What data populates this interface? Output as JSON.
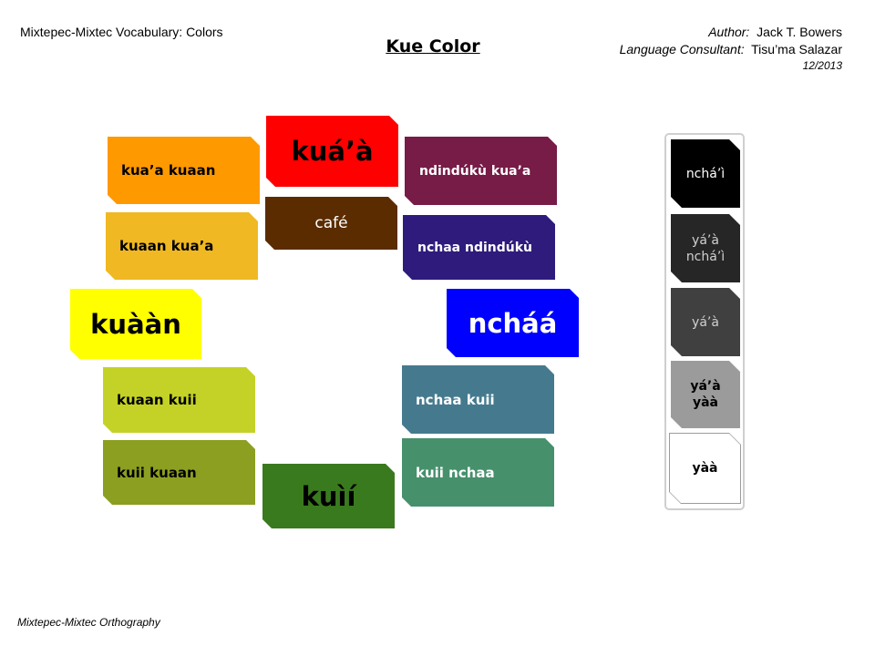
{
  "header": {
    "doc_title": "Mixtepec-Mixtec Vocabulary: Colors",
    "main_title": "Kue Color",
    "author_label": "Author:",
    "author_name": "Jack T. Bowers",
    "consultant_label": "Language Consultant:",
    "consultant_name": "Tisu’ma Salazar",
    "date": "12/2013"
  },
  "footer": {
    "orthography": "Mixtepec-Mixtec Orthography"
  },
  "colors": {
    "red": {
      "label": "kuá’à",
      "hex": "#ff0000"
    },
    "brown": {
      "label": "café",
      "hex": "#5a2c00"
    },
    "orange": {
      "label": "kua’a kuaan",
      "hex": "#ff9900"
    },
    "gold": {
      "label": "kuaan kua’a",
      "hex": "#f0b822"
    },
    "yellow": {
      "label": "kuààn",
      "hex": "#ffff00"
    },
    "yellow_green": {
      "label": "kuaan kuii",
      "hex": "#c4d227"
    },
    "olive": {
      "label": "kuii kuaan",
      "hex": "#8c9f20"
    },
    "green": {
      "label": "kuìí",
      "hex": "#3a7a1e"
    },
    "maroon": {
      "label": "ndindúkù kua’a",
      "hex": "#771b47"
    },
    "indigo": {
      "label": "nchaa ndindúkù",
      "hex": "#2f1b7c"
    },
    "blue": {
      "label": "ncháá",
      "hex": "#0000ff"
    },
    "teal_blue": {
      "label": "nchaa kuii",
      "hex": "#457a8e"
    },
    "teal_green": {
      "label": "kuii nchaa",
      "hex": "#47906c"
    }
  },
  "grays": [
    {
      "label": "nchá’ì",
      "hex": "#000000"
    },
    {
      "label": "yá’à nchá’ì",
      "hex": "#262626"
    },
    {
      "label": "yá’à",
      "hex": "#404040"
    },
    {
      "label": "yá’à yàà",
      "hex": "#9b9b9b"
    },
    {
      "label": "yàà",
      "hex": "#ffffff"
    }
  ]
}
